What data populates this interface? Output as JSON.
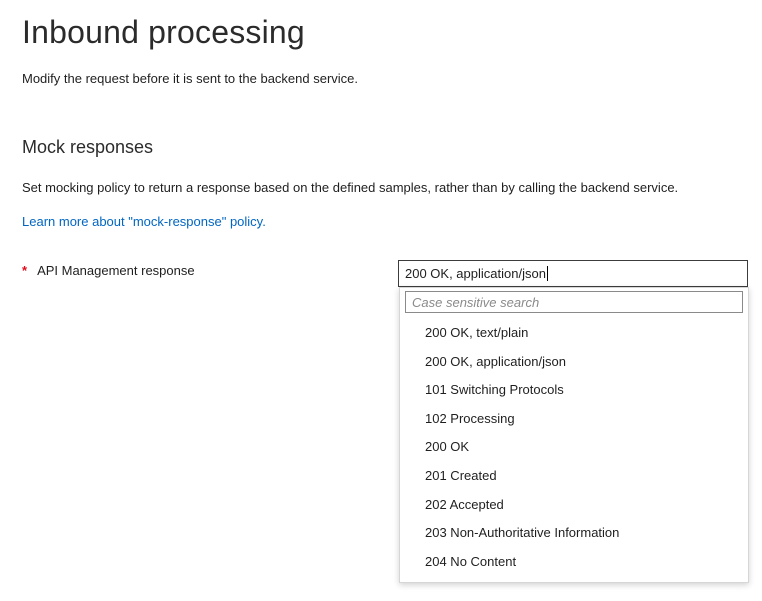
{
  "page": {
    "title": "Inbound processing",
    "subtitle": "Modify the request before it is sent to the backend service."
  },
  "mock_section": {
    "heading": "Mock responses",
    "description": "Set mocking policy to return a response based on the defined samples, rather than by calling the backend service.",
    "learn_more_link": "Learn more about \"mock-response\" policy."
  },
  "field": {
    "required_marker": "*",
    "label": "API Management response",
    "selected_value": "200 OK, application/json"
  },
  "dropdown": {
    "search_placeholder": "Case sensitive search",
    "options": [
      {
        "label": "200 OK, text/plain"
      },
      {
        "label": "200 OK, application/json"
      },
      {
        "label": "101 Switching Protocols"
      },
      {
        "label": "102 Processing"
      },
      {
        "label": "200 OK"
      },
      {
        "label": "201 Created"
      },
      {
        "label": "202 Accepted"
      },
      {
        "label": "203 Non-Authoritative Information"
      },
      {
        "label": "204 No Content"
      }
    ]
  },
  "colors": {
    "link": "#0066c2",
    "required": "#e00b1c"
  }
}
